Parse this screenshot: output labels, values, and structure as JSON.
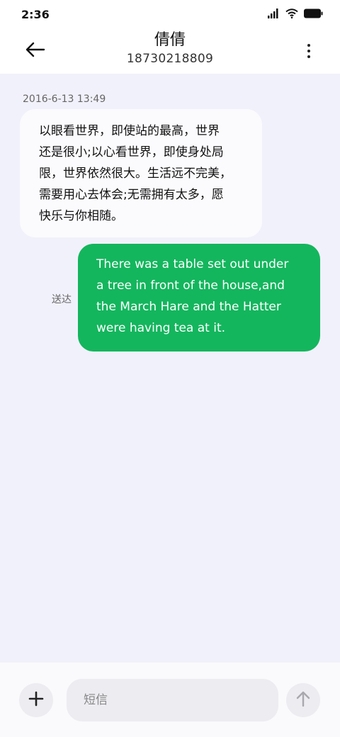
{
  "status_bar": {
    "time": "2:36",
    "icons": [
      "signal-icon",
      "wifi-icon",
      "battery-icon"
    ]
  },
  "header": {
    "contact_name": "倩倩",
    "contact_number": "18730218809",
    "back_icon": "arrow-left-icon",
    "more_icon": "more-vertical-icon"
  },
  "conversation": {
    "timestamp": "2016-6-13 13:49",
    "messages": [
      {
        "direction": "incoming",
        "lines": [
          "以眼看世界，即使站的最高，世界",
          "还是很小;以心看世界，即使身处局",
          "限，世界依然很大。生活远不完美，",
          "需要用心去体会;无需拥有太多，愿",
          "快乐与你相随。"
        ]
      },
      {
        "direction": "outgoing",
        "lines": [
          "There was a table set out under",
          "a tree in front of the house,and",
          "the March Hare and the Hatter",
          "were having tea at it."
        ],
        "status": "送达"
      }
    ]
  },
  "composer": {
    "placeholder": "短信",
    "value": "",
    "add_icon": "plus-icon",
    "send_icon": "arrow-up-icon"
  },
  "colors": {
    "background": "#f1f1fb",
    "outgoing_bubble": "#13b65d",
    "incoming_bubble": "#fbfbfe",
    "control_bg": "#ececf1"
  }
}
